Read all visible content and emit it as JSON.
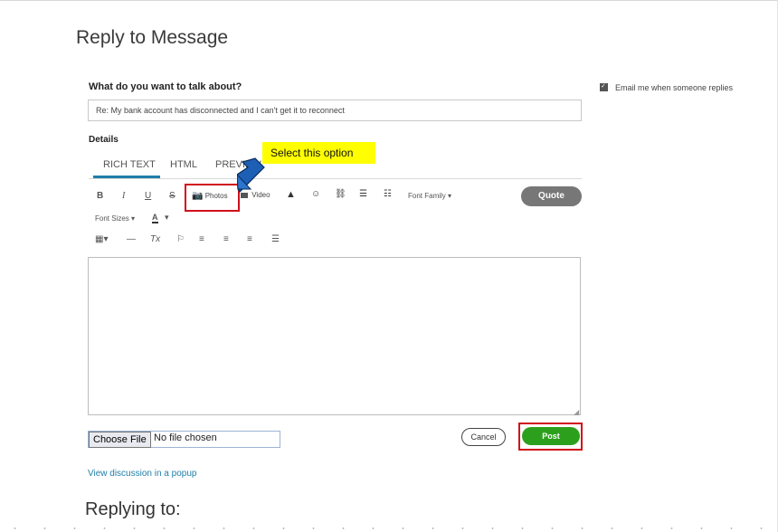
{
  "page": {
    "title": "Reply to Message",
    "topic_label": "What do you want to talk about?",
    "subject_value": "Re: My bank account has disconnected and I can't get it to reconnect",
    "email_option_label": "Email me when someone replies",
    "details_label": "Details"
  },
  "editor": {
    "tabs": [
      {
        "label": "RICH TEXT"
      },
      {
        "label": "HTML"
      },
      {
        "label": "PREVIEW"
      }
    ],
    "toolbar": {
      "bold": "B",
      "italic": "I",
      "underline": "U",
      "strike": "S",
      "photos": "Photos",
      "video": "Video",
      "font_family": "Font Family",
      "quote": "Quote",
      "font_sizes": "Font Sizes",
      "font_color": "A"
    }
  },
  "file": {
    "choose_label": "Choose File",
    "status": "No file chosen"
  },
  "actions": {
    "cancel": "Cancel",
    "post": "Post",
    "popup_link": "View discussion in a popup"
  },
  "replying": {
    "title": "Replying to:"
  },
  "annotation": {
    "tooltip": "Select this option",
    "highlight_color": "#ffff00",
    "box_color": "#d0101a"
  },
  "colors": {
    "accent": "#1f7ea8",
    "post": "#2ca01c",
    "quote": "#777777"
  }
}
